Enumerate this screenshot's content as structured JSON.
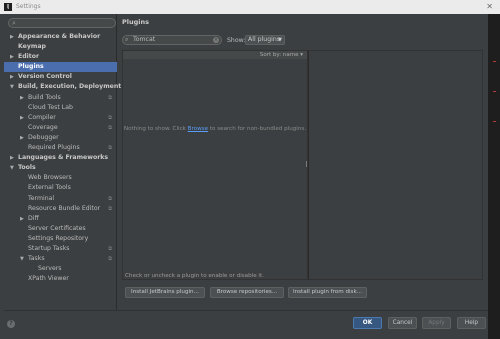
{
  "window": {
    "title": "Settings",
    "app_icon": "intellij-app-icon",
    "close_glyph": "✕"
  },
  "sidebar": {
    "search_placeholder": "",
    "items": [
      {
        "label": "Appearance & Behavior",
        "level": 0,
        "expandable": true,
        "expanded": false,
        "bold": true
      },
      {
        "label": "Keymap",
        "level": 0,
        "expandable": false,
        "bold": true
      },
      {
        "label": "Editor",
        "level": 0,
        "expandable": true,
        "expanded": false,
        "bold": true
      },
      {
        "label": "Plugins",
        "level": 0,
        "expandable": false,
        "bold": true,
        "selected": true
      },
      {
        "label": "Version Control",
        "level": 0,
        "expandable": true,
        "expanded": false,
        "bold": true
      },
      {
        "label": "Build, Execution, Deployment",
        "level": 0,
        "expandable": true,
        "expanded": true,
        "bold": true
      },
      {
        "label": "Build Tools",
        "level": 1,
        "expandable": true,
        "expanded": false,
        "cfg": true
      },
      {
        "label": "Cloud Test Lab",
        "level": 1,
        "expandable": false
      },
      {
        "label": "Compiler",
        "level": 1,
        "expandable": true,
        "expanded": false,
        "cfg": true
      },
      {
        "label": "Coverage",
        "level": 1,
        "expandable": false,
        "cfg": true
      },
      {
        "label": "Debugger",
        "level": 1,
        "expandable": true,
        "expanded": false
      },
      {
        "label": "Required Plugins",
        "level": 1,
        "expandable": false,
        "cfg": true
      },
      {
        "label": "Languages & Frameworks",
        "level": 0,
        "expandable": true,
        "expanded": false,
        "bold": true
      },
      {
        "label": "Tools",
        "level": 0,
        "expandable": true,
        "expanded": true,
        "bold": true
      },
      {
        "label": "Web Browsers",
        "level": 1,
        "expandable": false
      },
      {
        "label": "External Tools",
        "level": 1,
        "expandable": false
      },
      {
        "label": "Terminal",
        "level": 1,
        "expandable": false,
        "cfg": true
      },
      {
        "label": "Resource Bundle Editor",
        "level": 1,
        "expandable": false,
        "cfg": true
      },
      {
        "label": "Diff",
        "level": 1,
        "expandable": true,
        "expanded": false
      },
      {
        "label": "Server Certificates",
        "level": 1,
        "expandable": false
      },
      {
        "label": "Settings Repository",
        "level": 1,
        "expandable": false
      },
      {
        "label": "Startup Tasks",
        "level": 1,
        "expandable": false,
        "cfg": true
      },
      {
        "label": "Tasks",
        "level": 1,
        "expandable": true,
        "expanded": true,
        "cfg": true
      },
      {
        "label": "Servers",
        "level": 2,
        "expandable": false
      },
      {
        "label": "XPath Viewer",
        "level": 1,
        "expandable": false
      }
    ]
  },
  "plugins": {
    "title": "Plugins",
    "search_value": "Tomcat",
    "show_label": "Show:",
    "show_value": "All plugins",
    "sort_label": "Sort by: name",
    "empty_prefix": "Nothing to show. Click",
    "empty_link": "Browse",
    "empty_suffix": "to search for non-bundled plugins.",
    "hint": "Check or uncheck a plugin to enable or disable it.",
    "buttons": {
      "install_jetbrains": "Install JetBrains plugin...",
      "browse": "Browse repositories...",
      "install_disk": "Install plugin from disk..."
    }
  },
  "footer": {
    "ok": "OK",
    "cancel": "Cancel",
    "apply": "Apply",
    "help": "Help"
  },
  "colors": {
    "selection": "#4b6eaf",
    "link": "#589df6",
    "background": "#3c3f41"
  }
}
